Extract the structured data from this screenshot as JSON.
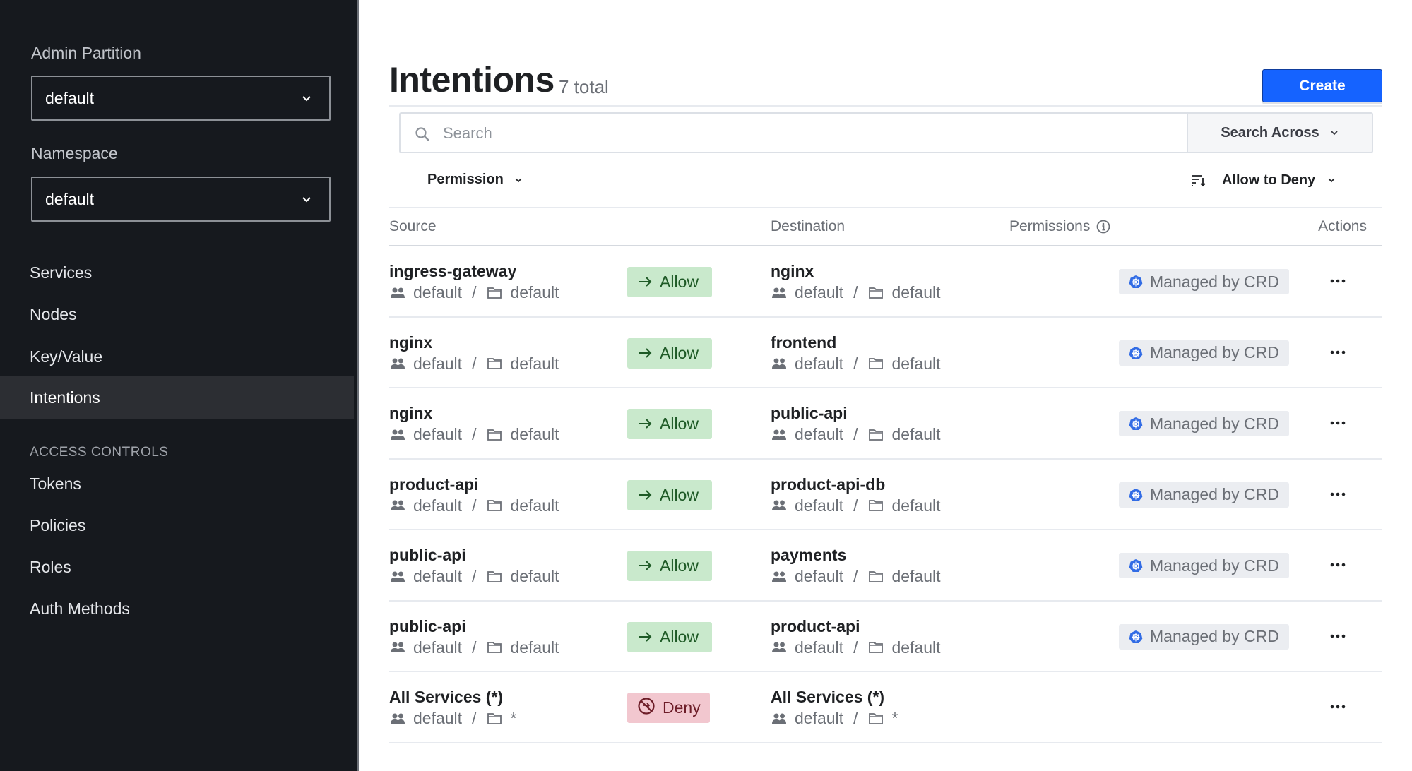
{
  "sidebar": {
    "partition_label": "Admin Partition",
    "partition_value": "default",
    "namespace_label": "Namespace",
    "namespace_value": "default",
    "nav": [
      {
        "label": "Services",
        "active": false
      },
      {
        "label": "Nodes",
        "active": false
      },
      {
        "label": "Key/Value",
        "active": false
      },
      {
        "label": "Intentions",
        "active": true
      }
    ],
    "section_label": "ACCESS CONTROLS",
    "access_nav": [
      {
        "label": "Tokens"
      },
      {
        "label": "Policies"
      },
      {
        "label": "Roles"
      },
      {
        "label": "Auth Methods"
      }
    ]
  },
  "header": {
    "title": "Intentions",
    "count": "7 total",
    "create_label": "Create"
  },
  "search": {
    "placeholder": "Search",
    "value": "",
    "across_label": "Search Across"
  },
  "filters": {
    "permission_label": "Permission",
    "sort_label": "Allow to Deny"
  },
  "table": {
    "columns": {
      "source": "Source",
      "destination": "Destination",
      "permissions": "Permissions",
      "actions": "Actions"
    },
    "rows": [
      {
        "source": "ingress-gateway",
        "source_partition": "default",
        "source_namespace": "default",
        "action": "Allow",
        "destination": "nginx",
        "dest_partition": "default",
        "dest_namespace": "default",
        "permission": "Managed by CRD"
      },
      {
        "source": "nginx",
        "source_partition": "default",
        "source_namespace": "default",
        "action": "Allow",
        "destination": "frontend",
        "dest_partition": "default",
        "dest_namespace": "default",
        "permission": "Managed by CRD"
      },
      {
        "source": "nginx",
        "source_partition": "default",
        "source_namespace": "default",
        "action": "Allow",
        "destination": "public-api",
        "dest_partition": "default",
        "dest_namespace": "default",
        "permission": "Managed by CRD"
      },
      {
        "source": "product-api",
        "source_partition": "default",
        "source_namespace": "default",
        "action": "Allow",
        "destination": "product-api-db",
        "dest_partition": "default",
        "dest_namespace": "default",
        "permission": "Managed by CRD"
      },
      {
        "source": "public-api",
        "source_partition": "default",
        "source_namespace": "default",
        "action": "Allow",
        "destination": "payments",
        "dest_partition": "default",
        "dest_namespace": "default",
        "permission": "Managed by CRD"
      },
      {
        "source": "public-api",
        "source_partition": "default",
        "source_namespace": "default",
        "action": "Allow",
        "destination": "product-api",
        "dest_partition": "default",
        "dest_namespace": "default",
        "permission": "Managed by CRD"
      },
      {
        "source": "All Services (*)",
        "source_partition": "default",
        "source_namespace": "*",
        "action": "Deny",
        "destination": "All Services (*)",
        "dest_partition": "default",
        "dest_namespace": "*",
        "permission": ""
      }
    ]
  },
  "colors": {
    "sidebar_bg": "#16191e",
    "primary": "#1563ff",
    "allow_bg": "#c9e9cc",
    "allow_fg": "#1e5a26",
    "deny_bg": "#f2c7cf",
    "deny_fg": "#6d1d28",
    "crd_icon": "#326ce5"
  }
}
